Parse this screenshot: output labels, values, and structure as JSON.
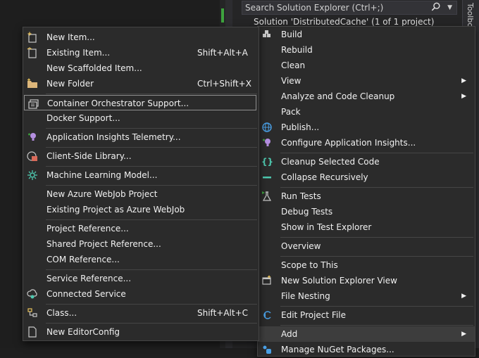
{
  "solution_explorer": {
    "search_placeholder": "Search Solution Explorer (Ctrl+;)",
    "tree_first_line": "Solution 'DistributedCache' (1 of 1 project)",
    "side_tab": "Toolbox"
  },
  "context_menu": {
    "items": [
      {
        "label": "Build",
        "icon": "build-icon"
      },
      {
        "label": "Rebuild"
      },
      {
        "label": "Clean"
      },
      {
        "label": "View",
        "submenu": true
      },
      {
        "label": "Analyze and Code Cleanup",
        "submenu": true
      },
      {
        "label": "Pack"
      },
      {
        "label": "Publish...",
        "icon": "globe-icon"
      },
      {
        "label": "Configure Application Insights...",
        "icon": "lightbulb-icon"
      },
      {
        "label": "Cleanup Selected Code",
        "icon": "braces-icon"
      },
      {
        "label": "Collapse Recursively",
        "icon": "collapse-icon"
      },
      {
        "label": "Run Tests",
        "icon": "flask-icon"
      },
      {
        "label": "Debug Tests"
      },
      {
        "label": "Show in Test Explorer"
      },
      {
        "label": "Overview"
      },
      {
        "label": "Scope to This"
      },
      {
        "label": "New Solution Explorer View",
        "icon": "new-window-icon"
      },
      {
        "label": "File Nesting",
        "submenu": true
      },
      {
        "label": "Edit Project File",
        "icon": "edit-arrow-icon"
      },
      {
        "label": "Add",
        "submenu": true,
        "highlighted": true
      },
      {
        "label": "Manage NuGet Packages..."
      }
    ]
  },
  "add_submenu": {
    "items": [
      {
        "label": "New Item...",
        "icon": "new-item-icon"
      },
      {
        "label": "Existing Item...",
        "shortcut": "Shift+Alt+A",
        "icon": "existing-item-icon"
      },
      {
        "label": "New Scaffolded Item..."
      },
      {
        "label": "New Folder",
        "shortcut": "Ctrl+Shift+X",
        "icon": "folder-icon"
      },
      {
        "label": "Container Orchestrator Support...",
        "icon": "container-icon",
        "focused": true
      },
      {
        "label": "Docker Support..."
      },
      {
        "label": "Application Insights Telemetry...",
        "icon": "lightbulb-icon"
      },
      {
        "label": "Client-Side Library...",
        "icon": "library-icon"
      },
      {
        "label": "Machine Learning Model...",
        "icon": "ml-icon"
      },
      {
        "label": "New Azure WebJob Project"
      },
      {
        "label": "Existing Project as Azure WebJob"
      },
      {
        "label": "Project Reference..."
      },
      {
        "label": "Shared Project Reference..."
      },
      {
        "label": "COM Reference..."
      },
      {
        "label": "Service Reference..."
      },
      {
        "label": "Connected Service",
        "icon": "connected-service-icon"
      },
      {
        "label": "Class...",
        "shortcut": "Shift+Alt+C",
        "icon": "class-icon"
      },
      {
        "label": "New EditorConfig",
        "icon": "file-icon"
      }
    ]
  },
  "colors": {
    "menu_bg": "#2b2b2b",
    "highlight": "#3d3d3d",
    "accent_green": "#3ea33e",
    "accent_blue": "#4aa0e6",
    "accent_purple": "#b48ee0"
  }
}
